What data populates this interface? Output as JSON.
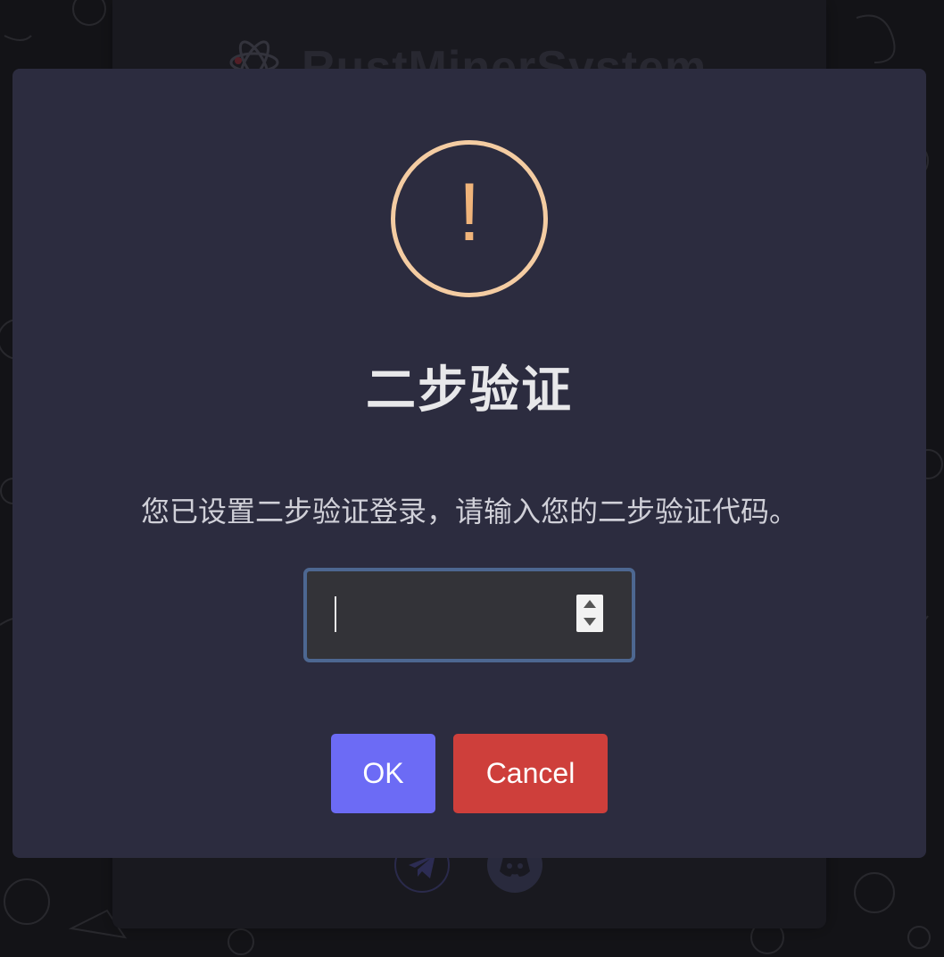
{
  "background": {
    "brand_name": "RustMinerSystem"
  },
  "modal": {
    "icon": "warning-exclamation-icon",
    "icon_glyph": "!",
    "title": "二步验证",
    "message": "您已设置二步验证登录，请输入您的二步验证代码。",
    "input_value": "",
    "ok_label": "OK",
    "cancel_label": "Cancel"
  },
  "colors": {
    "ok_button": "#6c6bf5",
    "cancel_button": "#ce3f3b",
    "warning_icon": "#f4cca2",
    "modal_background": "#2c2c3f"
  },
  "social_icons": [
    "telegram-icon",
    "discord-icon"
  ]
}
